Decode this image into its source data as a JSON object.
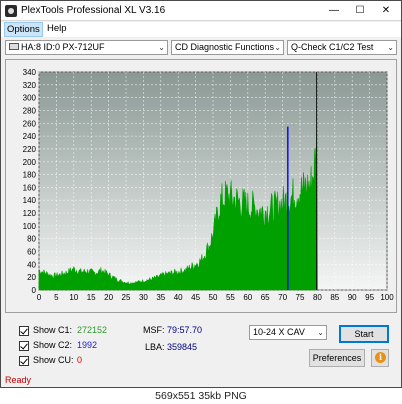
{
  "window": {
    "title": "PlexTools Professional XL V3.16"
  },
  "menu": {
    "options": "Options",
    "help": "Help"
  },
  "toolbar": {
    "drive": "HA:8 ID:0  PX-712UF",
    "function": "CD Diagnostic Functions",
    "test": "Q-Check C1/C2 Test"
  },
  "stats": {
    "c1_label": "Show C1:",
    "c1_value": "272152",
    "c2_label": "Show C2:",
    "c2_value": "1992",
    "cu_label": "Show CU:",
    "cu_value": "0",
    "msf_label": "MSF:",
    "msf_value": "79:57.70",
    "lba_label": "LBA:",
    "lba_value": "359845"
  },
  "controls": {
    "speed": "10-24 X CAV",
    "start": "Start",
    "preferences": "Preferences",
    "info": "i"
  },
  "status": "Ready",
  "footer": "569x551  35kb  PNG",
  "colors": {
    "c1": "#00a000",
    "c2": "#0000ff",
    "accent": "#0078d7"
  },
  "chart_data": {
    "type": "area",
    "xlim": [
      0,
      100
    ],
    "ylim": [
      0,
      340
    ],
    "xticks": [
      0,
      5,
      10,
      15,
      20,
      25,
      30,
      35,
      40,
      45,
      50,
      55,
      60,
      65,
      70,
      75,
      80,
      85,
      90,
      95,
      100
    ],
    "yticks": [
      0,
      20,
      40,
      60,
      80,
      100,
      120,
      140,
      160,
      180,
      200,
      220,
      240,
      260,
      280,
      300,
      320,
      340
    ],
    "grid": true,
    "series": [
      {
        "name": "C1",
        "x": [
          0,
          2,
          4,
          6,
          8,
          10,
          12,
          14,
          16,
          18,
          20,
          22,
          24,
          26,
          28,
          30,
          32,
          34,
          36,
          38,
          40,
          42,
          44,
          46,
          47,
          48,
          49,
          50,
          51,
          52,
          54,
          56,
          58,
          60,
          62,
          64,
          66,
          68,
          70,
          72,
          74,
          76,
          78,
          79,
          80
        ],
        "y": [
          28,
          24,
          20,
          22,
          25,
          30,
          26,
          27,
          24,
          28,
          22,
          16,
          12,
          10,
          11,
          13,
          15,
          18,
          22,
          24,
          26,
          28,
          34,
          40,
          45,
          55,
          65,
          80,
          100,
          125,
          135,
          130,
          125,
          120,
          118,
          112,
          115,
          118,
          125,
          130,
          140,
          145,
          150,
          170,
          215
        ]
      },
      {
        "name": "C2",
        "x": [
          71.3,
          71.5,
          71.7
        ],
        "y": [
          120,
          255,
          50
        ]
      }
    ],
    "end_marker_x": 79.8
  }
}
